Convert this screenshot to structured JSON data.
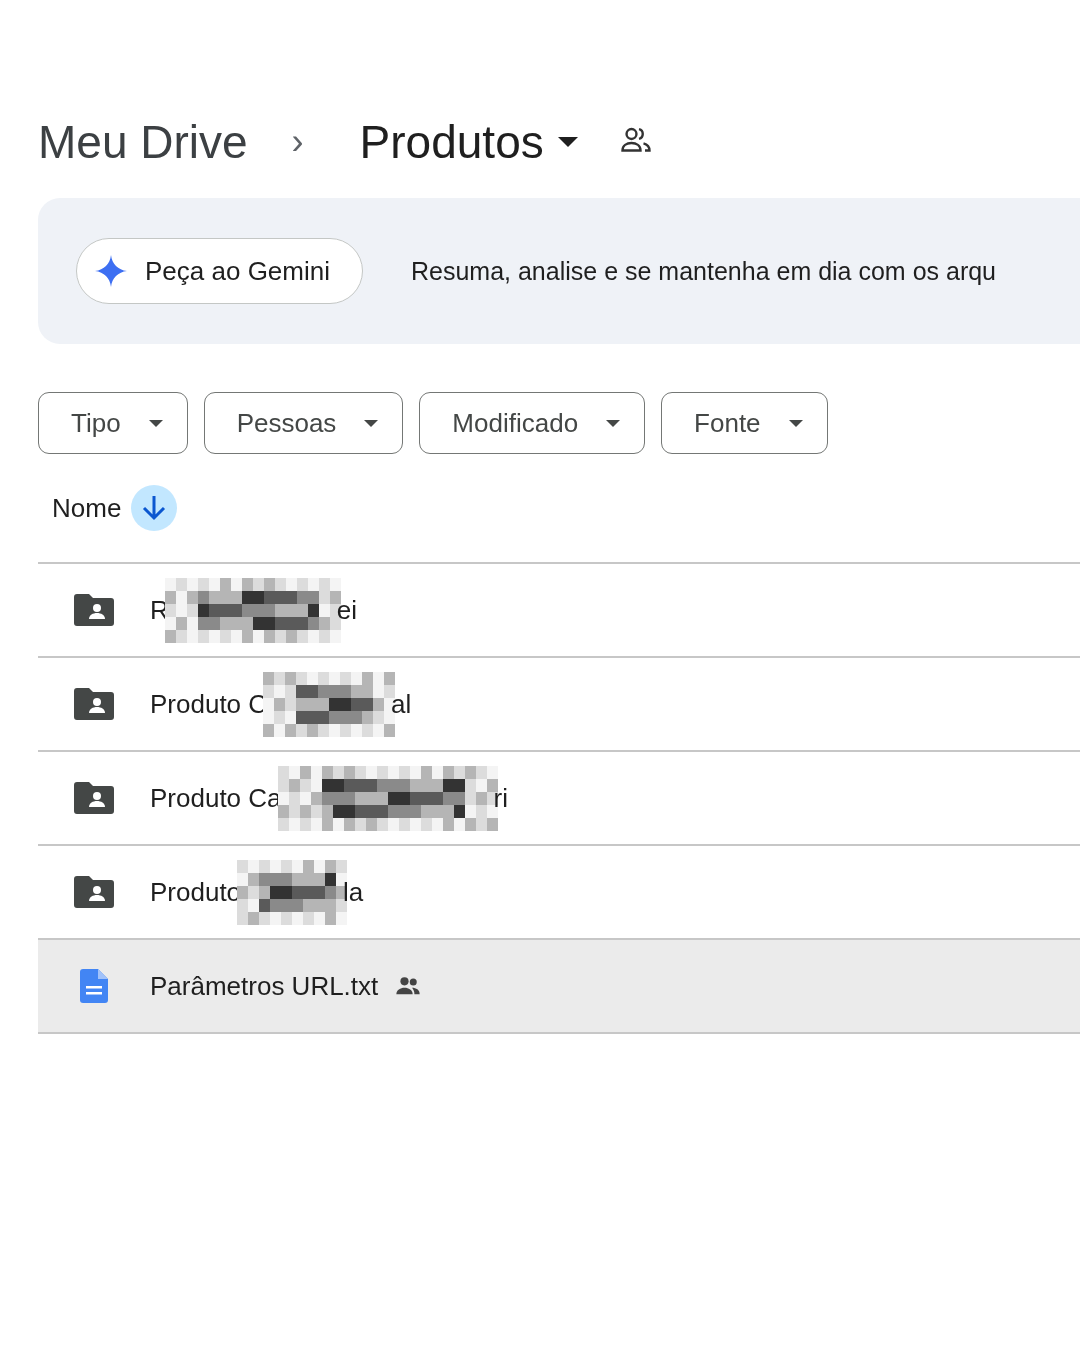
{
  "breadcrumb": {
    "root": "Meu Drive",
    "separator": "›",
    "current": "Produtos",
    "shared": true
  },
  "gemini": {
    "button": "Peça ao Gemini",
    "text": "Resuma, analise e se mantenha em dia com os arqu"
  },
  "filters": [
    "Tipo",
    "Pessoas",
    "Modificado",
    "Fonte"
  ],
  "sort": {
    "label": "Nome"
  },
  "files": [
    {
      "kind": "shared-folder",
      "name_start": "R",
      "redacted": true,
      "name_end": "ei",
      "selected": false
    },
    {
      "kind": "shared-folder",
      "name_start": "Produto C",
      "redacted": true,
      "name_end": "al",
      "selected": false
    },
    {
      "kind": "shared-folder",
      "name_start": "Produto Ca",
      "redacted": true,
      "name_end": "ri",
      "selected": false
    },
    {
      "kind": "shared-folder",
      "name_start": "Produto",
      "redacted": true,
      "name_end": "la",
      "selected": false
    },
    {
      "kind": "doc",
      "name_start": "Parâmetros URL.txt",
      "redacted": false,
      "shared": true,
      "selected": true
    }
  ]
}
